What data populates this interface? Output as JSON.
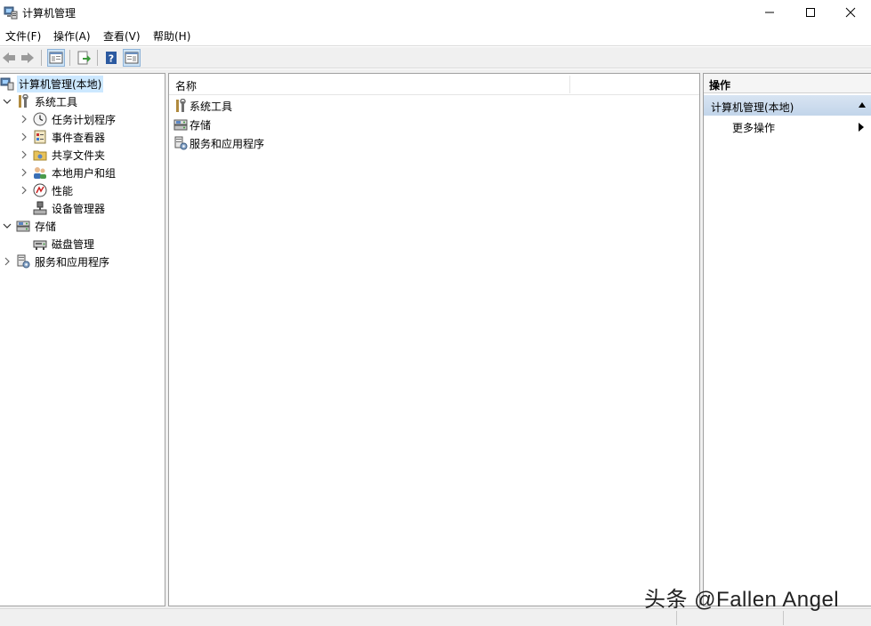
{
  "window": {
    "title": "计算机管理",
    "controls": {
      "minimize": "minimize-icon",
      "maximize": "maximize-icon",
      "close": "close-icon"
    }
  },
  "menu": {
    "items": [
      "文件(F)",
      "操作(A)",
      "查看(V)",
      "帮助(H)"
    ]
  },
  "toolbar": {
    "buttons": [
      "back-arrow-icon",
      "forward-arrow-icon",
      "show-hide-tree-icon",
      "export-list-icon",
      "help-icon",
      "show-hide-action-pane-icon"
    ]
  },
  "tree": {
    "root": "计算机管理(本地)",
    "system_tools": {
      "label": "系统工具",
      "children": [
        "任务计划程序",
        "事件查看器",
        "共享文件夹",
        "本地用户和组",
        "性能",
        "设备管理器"
      ]
    },
    "storage": {
      "label": "存储",
      "children": [
        "磁盘管理"
      ]
    },
    "services": {
      "label": "服务和应用程序"
    }
  },
  "list": {
    "column_name": "名称",
    "rows": [
      "系统工具",
      "存储",
      "服务和应用程序"
    ]
  },
  "actions": {
    "header": "操作",
    "section": "计算机管理(本地)",
    "more": "更多操作"
  },
  "watermark": "头条 @Fallen Angel",
  "colors": {
    "selection": "#cce8ff",
    "section_bar": "#c9d9ec",
    "chrome": "#f0f0f0"
  }
}
